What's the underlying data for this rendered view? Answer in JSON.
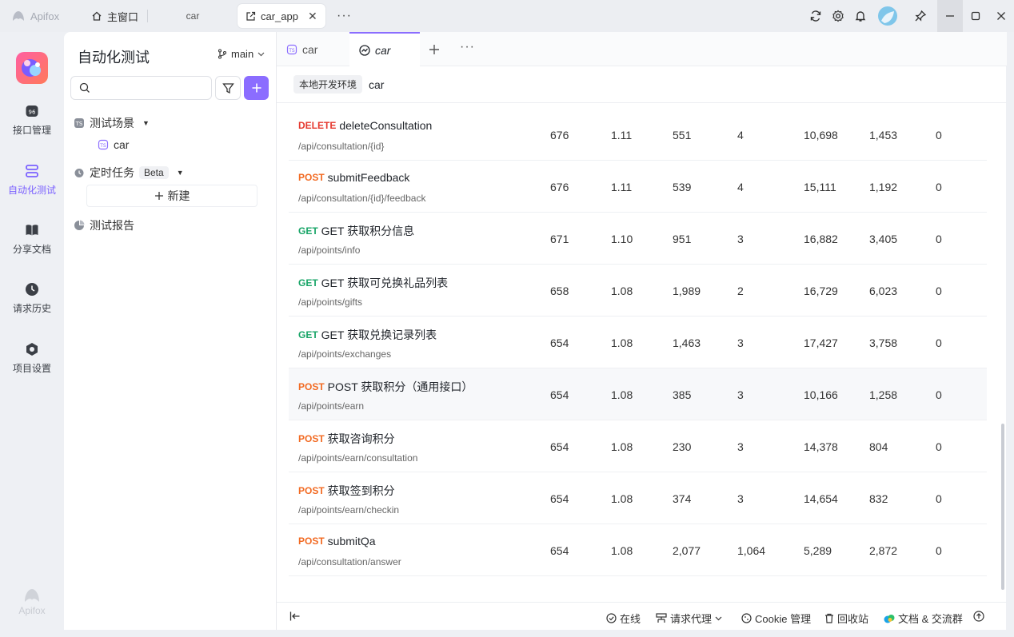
{
  "titlebar": {
    "app_name": "Apifox",
    "home_tab": "主窗口",
    "tab2": "car",
    "active_tab": "car_app"
  },
  "nav": {
    "items": [
      {
        "label": "接口管理"
      },
      {
        "label": "自动化测试"
      },
      {
        "label": "分享文档"
      },
      {
        "label": "请求历史"
      },
      {
        "label": "项目设置"
      }
    ],
    "footer_brand": "Apifox"
  },
  "sidebar": {
    "title": "自动化测试",
    "branch": "main",
    "search_placeholder": "",
    "section_scenes": "测试场景",
    "scene_item": "car",
    "section_scheduled": "定时任务",
    "beta_badge": "Beta",
    "new_label": "新建",
    "section_reports": "测试报告"
  },
  "main": {
    "tabs": [
      {
        "label": "car"
      },
      {
        "label": "car"
      }
    ],
    "env_chip": "本地开发环境",
    "env_name": "car"
  },
  "colors": {
    "accent": "#8b6dff",
    "delete": "#e5392f",
    "post": "#f26a22",
    "get": "#19a568"
  },
  "rows": [
    {
      "method": "DELETE",
      "name": "deleteConsultation",
      "path": "/api/consultation/{id}",
      "c1": "676",
      "c2": "1.11",
      "c3": "551",
      "c4": "4",
      "c5": "10,698",
      "c6": "1,453",
      "c7": "0"
    },
    {
      "method": "POST",
      "name": "submitFeedback",
      "path": "/api/consultation/{id}/feedback",
      "c1": "676",
      "c2": "1.11",
      "c3": "539",
      "c4": "4",
      "c5": "15,111",
      "c6": "1,192",
      "c7": "0"
    },
    {
      "method": "GET",
      "name": "GET 获取积分信息",
      "path": "/api/points/info",
      "c1": "671",
      "c2": "1.10",
      "c3": "951",
      "c4": "3",
      "c5": "16,882",
      "c6": "3,405",
      "c7": "0"
    },
    {
      "method": "GET",
      "name": "GET 获取可兑换礼品列表",
      "path": "/api/points/gifts",
      "c1": "658",
      "c2": "1.08",
      "c3": "1,989",
      "c4": "2",
      "c5": "16,729",
      "c6": "6,023",
      "c7": "0"
    },
    {
      "method": "GET",
      "name": "GET 获取兑换记录列表",
      "path": "/api/points/exchanges",
      "c1": "654",
      "c2": "1.08",
      "c3": "1,463",
      "c4": "3",
      "c5": "17,427",
      "c6": "3,758",
      "c7": "0"
    },
    {
      "method": "POST",
      "name": "POST 获取积分（通用接口）",
      "path": "/api/points/earn",
      "c1": "654",
      "c2": "1.08",
      "c3": "385",
      "c4": "3",
      "c5": "10,166",
      "c6": "1,258",
      "c7": "0"
    },
    {
      "method": "POST",
      "name": "获取咨询积分",
      "path": "/api/points/earn/consultation",
      "c1": "654",
      "c2": "1.08",
      "c3": "230",
      "c4": "3",
      "c5": "14,378",
      "c6": "804",
      "c7": "0"
    },
    {
      "method": "POST",
      "name": "获取签到积分",
      "path": "/api/points/earn/checkin",
      "c1": "654",
      "c2": "1.08",
      "c3": "374",
      "c4": "3",
      "c5": "14,654",
      "c6": "832",
      "c7": "0"
    },
    {
      "method": "POST",
      "name": "submitQa",
      "path": "/api/consultation/answer",
      "c1": "654",
      "c2": "1.08",
      "c3": "2,077",
      "c4": "1,064",
      "c5": "5,289",
      "c6": "2,872",
      "c7": "0"
    }
  ],
  "footer": {
    "online": "在线",
    "proxy": "请求代理",
    "cookie": "Cookie 管理",
    "recycle": "回收站",
    "docs": "文档 & 交流群"
  }
}
